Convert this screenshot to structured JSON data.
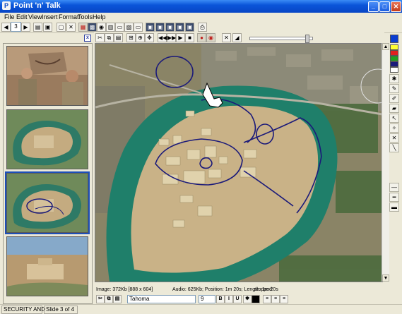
{
  "window": {
    "title": "Point 'n' Talk",
    "minimize": "_",
    "maximize": "□",
    "close": "✕"
  },
  "menu": [
    "File",
    "Edit",
    "View",
    "Insert",
    "Format",
    "Tools",
    "Help"
  ],
  "toolbar": {
    "slide_number": "3"
  },
  "thumbs_close": "x",
  "status": {
    "image": "Image: 372Kb [888 x 604]",
    "audio": "Audio: 625Kb; Position: 1m 20s; Length: 1m 20s",
    "state": "stopped"
  },
  "format": {
    "font": "Tahoma",
    "size": "9",
    "bold": "B",
    "italic": "I",
    "underline": "U"
  },
  "bottom": {
    "left": "SECURITY AND",
    "slide": "Slide 3 of 4"
  },
  "colors": {
    "title_blue": "#0846c5",
    "ink_blue": "#1b1a7a",
    "river": "#1f7f6a",
    "land": "#c9b287"
  },
  "icons": [
    "search-icon",
    "pointer-icon",
    "pen-icon",
    "eraser-icon",
    "play-icon",
    "stop-icon",
    "record-icon"
  ]
}
